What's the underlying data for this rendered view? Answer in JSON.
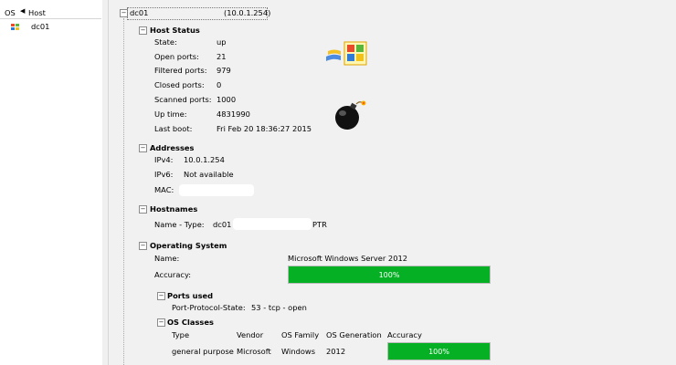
{
  "sidebar": {
    "os_header": "OS",
    "host_header": "Host",
    "hosts": [
      {
        "name": "dc01"
      }
    ]
  },
  "host": {
    "name": "dc01",
    "address": "(10.0.1.254)"
  },
  "host_status": {
    "title": "Host Status",
    "rows": [
      {
        "label": "State:",
        "value": "up"
      },
      {
        "label": "Open ports:",
        "value": "21"
      },
      {
        "label": "Filtered ports:",
        "value": "979"
      },
      {
        "label": "Closed ports:",
        "value": "0"
      },
      {
        "label": "Scanned ports:",
        "value": "1000"
      },
      {
        "label": "Up time:",
        "value": "4831990"
      },
      {
        "label": "Last boot:",
        "value": "Fri Feb 20 18:36:27 2015"
      }
    ]
  },
  "addresses": {
    "title": "Addresses",
    "ipv4_label": "IPv4:",
    "ipv4": "10.0.1.254",
    "ipv6_label": "IPv6:",
    "ipv6": "Not available",
    "mac_label": "MAC:"
  },
  "hostnames": {
    "title": "Hostnames",
    "label": "Name - Type:",
    "name_start": "dc01",
    "type": "PTR"
  },
  "operating_system": {
    "title": "Operating System",
    "name_label": "Name:",
    "name": "Microsoft Windows Server 2012",
    "accuracy_label": "Accuracy:",
    "accuracy": "100%",
    "accuracy_fraction": 1.0
  },
  "ports_used": {
    "title": "Ports used",
    "label": "Port-Protocol-State:",
    "value": "53 - tcp - open"
  },
  "os_classes": {
    "title": "OS Classes",
    "columns": [
      "Type",
      "Vendor",
      "OS Family",
      "OS Generation",
      "Accuracy"
    ],
    "rows": [
      {
        "type": "general purpose",
        "vendor": "Microsoft",
        "family": "Windows",
        "generation": "2012",
        "accuracy": "100%",
        "accuracy_fraction": 1.0
      }
    ]
  },
  "icons": {
    "collapse_box": "⊟",
    "os_icon": "windows-logo-icon",
    "difficulty_icon": "bomb-icon"
  },
  "colors": {
    "progress_green": "#06b025",
    "pane_background": "#f1f1f1"
  }
}
